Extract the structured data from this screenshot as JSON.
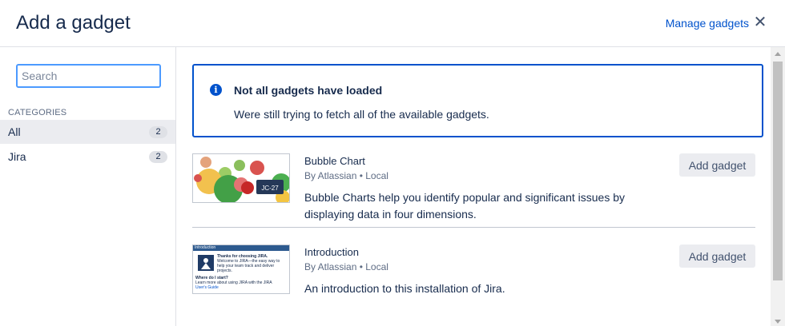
{
  "header": {
    "title": "Add a gadget",
    "manage_label": "Manage gadgets",
    "close_glyph": "✕"
  },
  "sidebar": {
    "search_placeholder": "Search",
    "categories_heading": "CATEGORIES",
    "categories": [
      {
        "label": "All",
        "count": "2",
        "active": true
      },
      {
        "label": "Jira",
        "count": "2",
        "active": false
      }
    ]
  },
  "banner": {
    "icon": "info-icon",
    "icon_glyph": "i",
    "title": "Not all gadgets have loaded",
    "text": "Were still trying to fetch all of the available gadgets."
  },
  "gadgets": [
    {
      "name": "Bubble Chart",
      "author": "By Atlassian • Local",
      "description": "Bubble Charts help you identify popular and significant issues by displaying data in four dimensions.",
      "button": "Add gadget",
      "thumb_tag": "JC-27"
    },
    {
      "name": "Introduction",
      "author": "By Atlassian • Local",
      "description": "An introduction to this installation of Jira.",
      "button": "Add gadget",
      "thumb_title": "Introduction",
      "thumb_lines": [
        "Thanks for choosing JIRA.",
        "Welcome to JIRA—the easy way to",
        "help your team track and deliver",
        "projects.",
        "Where do I start?",
        "Learn more about using JIRA with the JIRA",
        "User's Guide"
      ]
    }
  ],
  "colors": {
    "accent": "#0052cc",
    "text": "#172b4d",
    "subtle": "#5e6c84",
    "button_bg": "#ebecf0"
  }
}
